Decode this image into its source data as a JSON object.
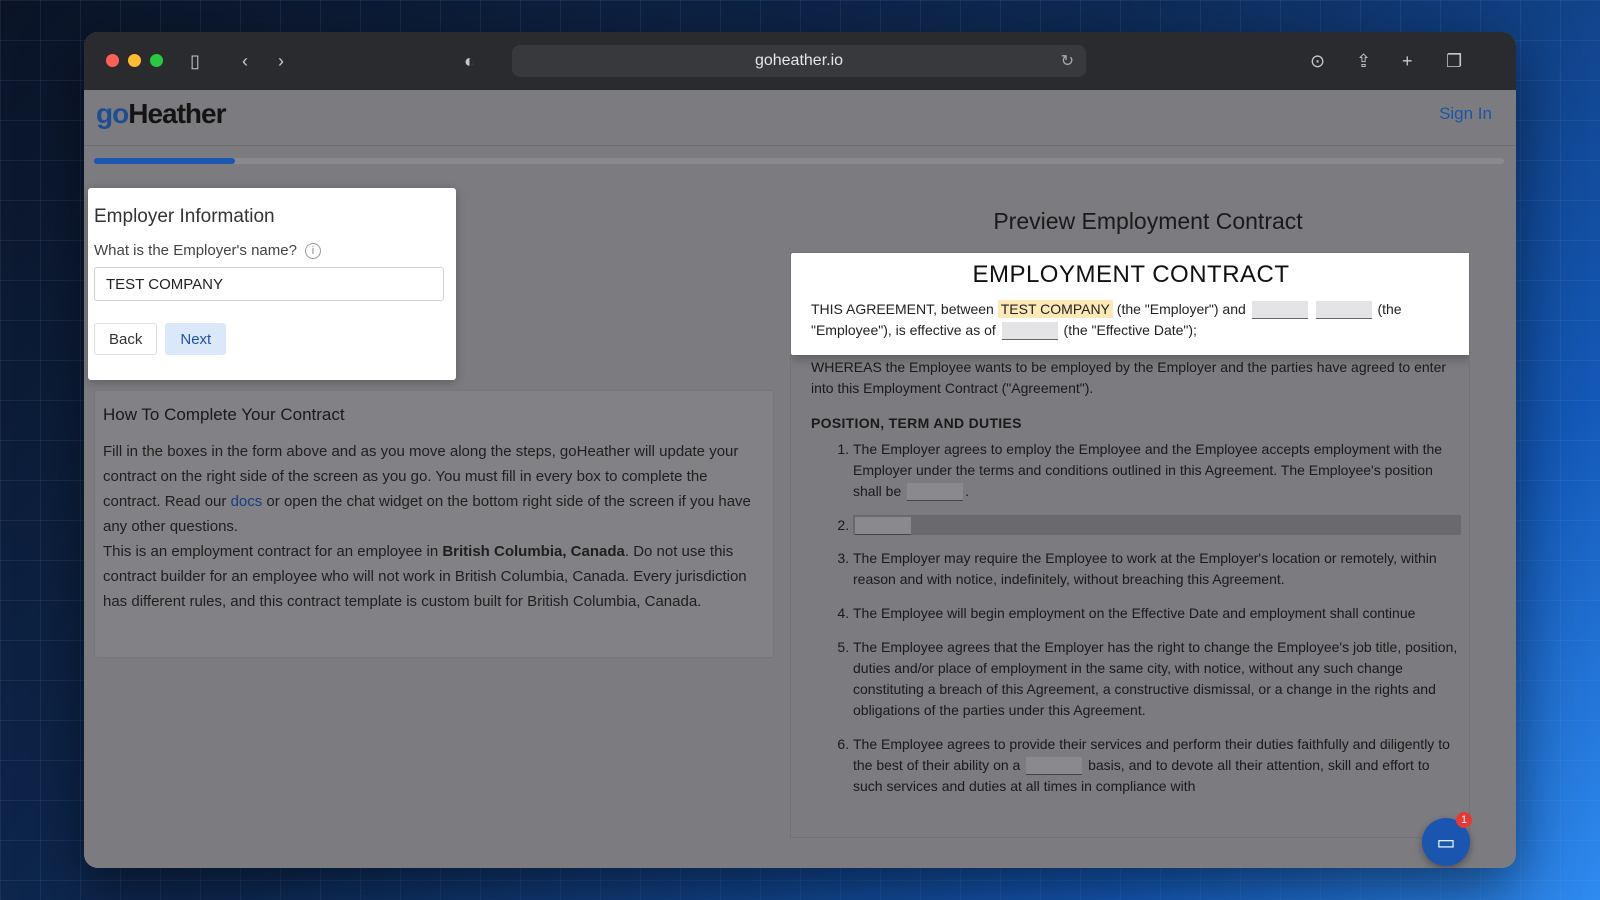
{
  "browser": {
    "url": "goheather.io"
  },
  "site": {
    "logo_go": "go",
    "logo_heather": "Heather",
    "sign_in": "Sign In",
    "progress": 0.1
  },
  "form": {
    "title": "Employer Information",
    "question": "What is the Employer's name?",
    "value": "TEST COMPANY",
    "back_label": "Back",
    "next_label": "Next"
  },
  "howto": {
    "title": "How To Complete Your Contract",
    "p1_a": "Fill in the boxes in the form above and as you move along the steps, goHeather will update your contract on the right side of the screen as you go. You must fill in every box to complete the contract. Read our ",
    "p1_link": "docs",
    "p1_b": " or open the chat widget on the bottom right side of the screen if you have any other questions.",
    "p2_a": "This is an employment contract for an employee in ",
    "p2_bold": "British Columbia, Canada",
    "p2_b": ". Do not use this contract builder for an employee who will not work in British Columbia, Canada. Every jurisdiction has different rules, and this contract template is custom built for British Columbia, Canada."
  },
  "preview": {
    "title": "Preview Employment Contract",
    "contract_title": "EMPLOYMENT CONTRACT",
    "intro_a": "THIS AGREEMENT, between ",
    "employer_name": "TEST COMPANY",
    "intro_b": " (the \"Employer\") and ",
    "intro_c": " (the \"Employee\"), is effective as of ",
    "intro_d": " (the \"Effective Date\");",
    "whereas": "WHEREAS the Employee wants to be employed by the Employer and the parties have agreed to enter into this Employment Contract (\"Agreement\").",
    "section_heading": "POSITION, TERM AND DUTIES",
    "item1_a": "The Employer agrees to employ the Employee and the Employee accepts employment with the Employer under the terms and conditions outlined in this Agreement. The Employee's position shall be ",
    "item1_b": ".",
    "item3": "The Employer may require the Employee to work at the Employer's location or remotely, within reason and with notice, indefinitely, without breaching this Agreement.",
    "item4": "The Employee will begin employment on the Effective Date and employment shall continue",
    "item5": "The Employee agrees that the Employer has the right to change the Employee's job title, position, duties and/or place of employment in the same city, with notice, without any such change constituting a breach of this Agreement, a constructive dismissal, or a change in the rights and obligations of the parties under this Agreement.",
    "item6_a": "The Employee agrees to provide their services and perform their duties faithfully and diligently to the best of their ability on a ",
    "item6_b": " basis, and to devote all their attention, skill and effort to such services and duties at all times in compliance with"
  },
  "chat": {
    "badge_count": "1"
  }
}
